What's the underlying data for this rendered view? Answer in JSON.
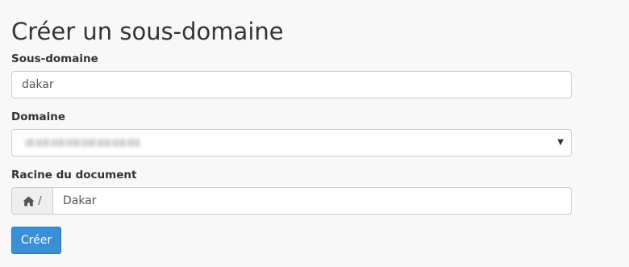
{
  "page": {
    "title": "Créer un sous-domaine"
  },
  "form": {
    "subdomain": {
      "label": "Sous-domaine",
      "value": "dakar"
    },
    "domain": {
      "label": "Domaine",
      "value_redacted": true
    },
    "document_root": {
      "label": "Racine du document",
      "prefix_icon": "home-icon",
      "prefix_text": "/",
      "value": "Dakar"
    },
    "submit_label": "Créer"
  },
  "colors": {
    "background": "#f8f8f8",
    "primary_button": "#3a8fd6",
    "border": "#cccccc",
    "addon_background": "#eeeeee"
  }
}
